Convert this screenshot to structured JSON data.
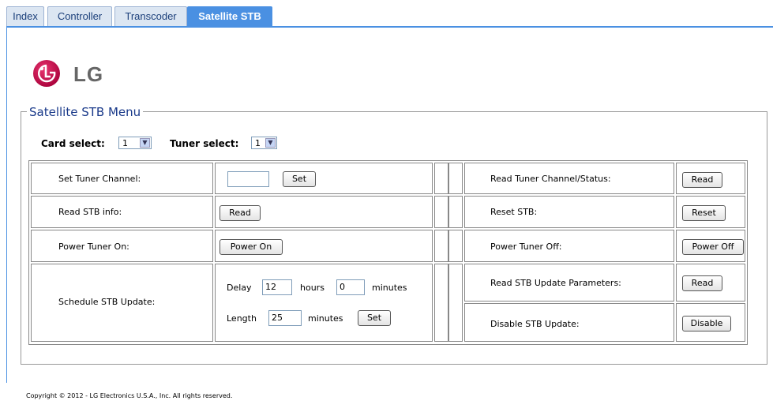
{
  "tabs": [
    "Index",
    "Controller",
    "Transcoder",
    "Satellite STB"
  ],
  "logo_text": "LG",
  "menu_title": "Satellite STB Menu",
  "card_select": {
    "label": "Card select:",
    "value": "1"
  },
  "tuner_select": {
    "label": "Tuner select:",
    "value": "1"
  },
  "rows": {
    "set_channel_label": "Set Tuner Channel:",
    "set_channel_value": "",
    "set_button": "Set",
    "read_channel_label": "Read Tuner Channel/Status:",
    "read_button": "Read",
    "read_info_label": "Read STB info:",
    "reset_label": "Reset STB:",
    "reset_button": "Reset",
    "power_on_label": "Power Tuner On:",
    "power_on_button": "Power On",
    "power_off_label": "Power Tuner Off:",
    "power_off_button": "Power Off",
    "schedule_label": "Schedule STB Update:",
    "delay_label": "Delay",
    "delay_hours": "12",
    "hours_label": "hours",
    "delay_minutes": "0",
    "minutes_label": "minutes",
    "length_label": "Length",
    "length_value": "25",
    "read_update_label": "Read STB Update Parameters:",
    "disable_label": "Disable STB Update:",
    "disable_button": "Disable"
  },
  "copyright": "Copyright © 2012 - LG Electronics U.S.A., Inc. All rights reserved.",
  "colors": {
    "accent": "#4a90e2",
    "logo_red": "#c4004a",
    "title_blue": "#1a3a8a"
  }
}
